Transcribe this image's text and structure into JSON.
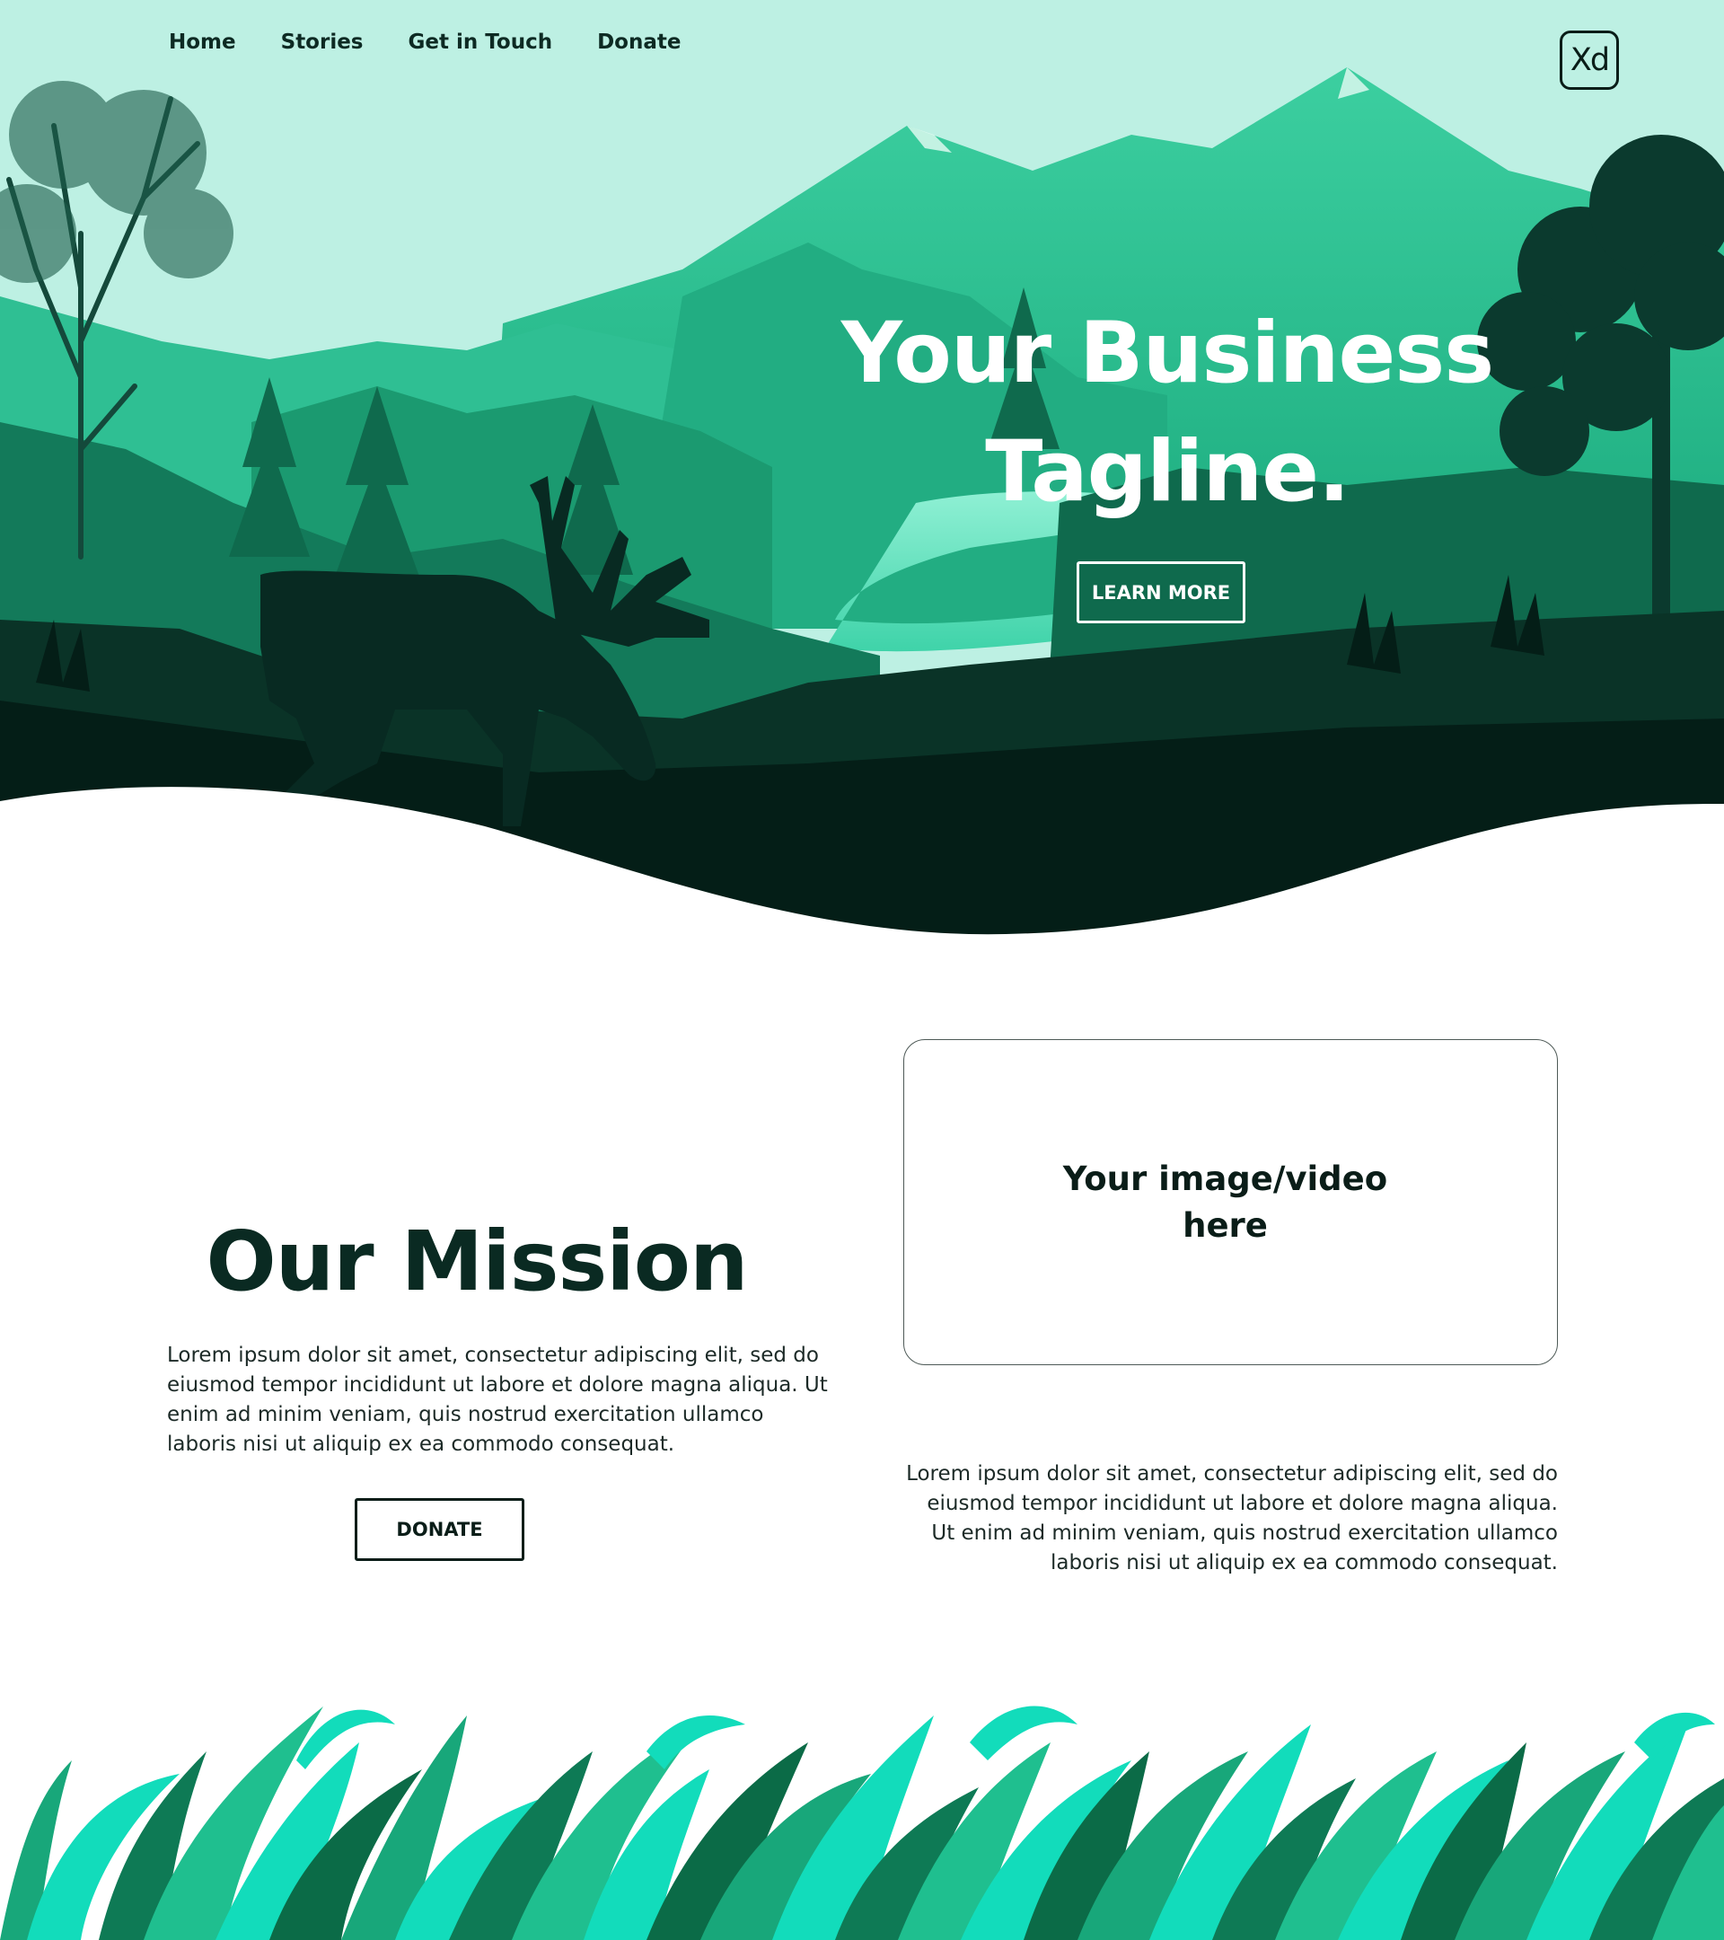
{
  "nav": {
    "items": [
      "Home",
      "Stories",
      "Get in Touch",
      "Donate"
    ]
  },
  "logo": {
    "text": "Xd"
  },
  "hero": {
    "title_line1": "Your Business",
    "title_line2": "Tagline.",
    "cta": "LEARN MORE"
  },
  "mission": {
    "title": "Our Mission",
    "body": "Lorem ipsum dolor sit amet, consectetur adipiscing elit, sed do eiusmod tempor incididunt ut labore et dolore magna aliqua. Ut enim ad minim veniam, quis nostrud exercitation ullamco laboris nisi ut aliquip ex ea commodo consequat.",
    "button": "DONATE"
  },
  "media": {
    "label_line1": "Your image/video",
    "label_line2": "here"
  },
  "side": {
    "body": "Lorem ipsum dolor sit amet, consectetur adipiscing elit, sed do eiusmod tempor incididunt ut labore et dolore magna aliqua. Ut enim ad minim veniam, quis nostrud exercitation ullamco laboris nisi ut aliquip ex ea commodo consequat."
  },
  "colors": {
    "sky": "#bdf0e3",
    "accent": "#1fbf8f",
    "dark_green": "#041e17",
    "lake": "#5fe2bf",
    "grass_bright": "#12dcbb"
  },
  "icons": [
    "xd-logo",
    "deer-silhouette",
    "mountain-landscape",
    "grass-illustration"
  ]
}
